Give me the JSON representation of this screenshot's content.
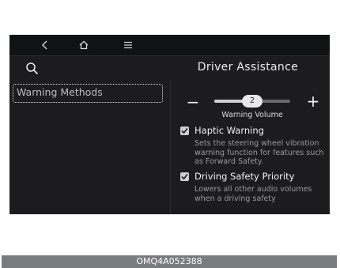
{
  "topbar": {
    "back_icon": "back-chevron-icon",
    "home_icon": "home-icon",
    "menu_icon": "menu-icon"
  },
  "header": {
    "title": "Driver Assistance",
    "search_icon": "search-icon"
  },
  "sidebar": {
    "items": [
      {
        "label": "Warning Methods",
        "selected": true
      }
    ]
  },
  "volume": {
    "label": "Warning Volume",
    "value": "2",
    "level_fraction": 0.5,
    "minus_label": "−",
    "plus_label": "+"
  },
  "options": [
    {
      "title": "Haptic Warning",
      "checked": true,
      "description": "Sets the steering wheel vibration warning function for features such as Forward Safety."
    },
    {
      "title": "Driving Safety Priority",
      "checked": true,
      "description": "Lowers all other audio volumes when a driving safety"
    }
  ],
  "caption": "OMQ4A052388",
  "colors": {
    "screen_bg": "#1c1c1e",
    "caption_bg": "#7a7b7d",
    "text_primary": "#f2f2f2",
    "text_secondary": "#9a9a9a"
  }
}
